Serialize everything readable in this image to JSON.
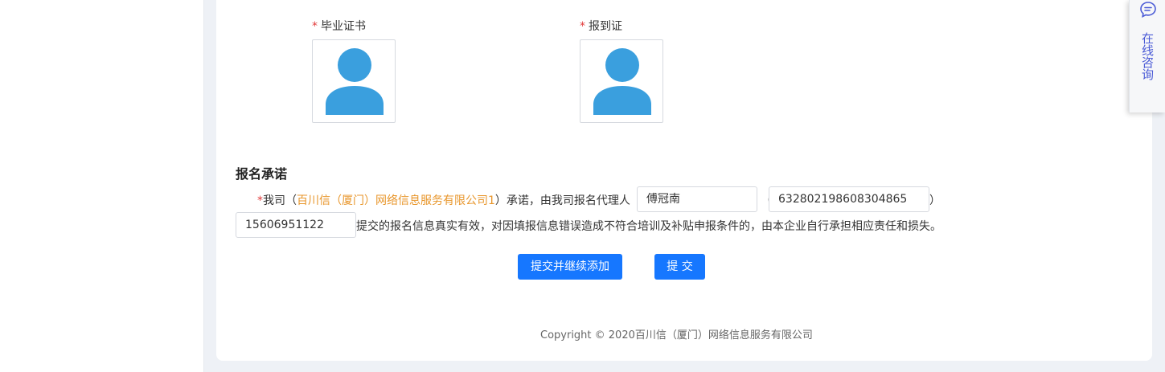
{
  "certificates": [
    {
      "label": "毕业证书",
      "required_mark": "*",
      "icon": "person-avatar-icon"
    },
    {
      "label": "报到证",
      "required_mark": "*",
      "icon": "person-avatar-icon"
    }
  ],
  "pledge": {
    "title": "报名承诺",
    "required_mark": "*",
    "text_we": "我司（",
    "company": "百川信（厦门）网络信息服务有限公司1",
    "text_promise": "）承诺，由我司报名代理人",
    "agent_name": "傅冠南",
    "paren_open": "（",
    "id_number": "632802198608304865",
    "paren_close": "）",
    "phone": "15606951122",
    "text_tail": "提交的报名信息真实有效，对因填报信息错误造成不符合培训及补贴申报条件的，由本企业自行承担相应责任和损失。"
  },
  "buttons": {
    "submit_continue": "提交并继续添加",
    "submit": "提 交"
  },
  "footer": {
    "copyright": "Copyright © 2020百川信（厦门）网络信息服务有限公司"
  },
  "consult": {
    "label": "在线咨询",
    "icon": "chat-bubble-icon"
  },
  "colors": {
    "accent": "#1677ff",
    "required": "#e23c3c",
    "company": "#e8962b",
    "avatar": "#3a9fde",
    "consult_text": "#4b5bd6"
  }
}
